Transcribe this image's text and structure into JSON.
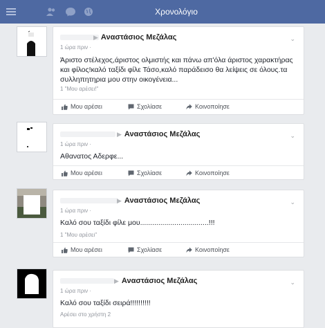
{
  "header": {
    "title": "Χρονολόγιο",
    "icons": [
      "menu-icon",
      "friends-icon",
      "messenger-icon",
      "globe-icon"
    ],
    "color": "#4e69a2"
  },
  "posts": [
    {
      "author": "Αναστάσιος Μεζάλας",
      "time": "1 ώρα πριν ·",
      "text": "Άριστο στέλεχος,άριστος ολμιστής και πάνω απ'όλα άριστος χαρακτήρας και φίλος!καλό ταξίδι φίλε Τάσο,καλό παράδεισο θα λείψεις σε όλους.τα συλληπητηρια μου στην οικογένεια...",
      "likes": "1 \"Μου αρέσει!\"",
      "actions": [
        "Μου αρέσει",
        "Σχολίασε",
        "Κοινοποίησε"
      ]
    },
    {
      "author": "Αναστάσιος Μεζάλας",
      "time": "1 ώρα πριν ·",
      "text": "Αθανατος Αδερφε...",
      "actions": [
        "Μου αρέσει",
        "Σχολίασε",
        "Κοινοποίησε"
      ]
    },
    {
      "author": "Αναστάσιος Μεζάλας",
      "time": "1 ώρα πριν ·",
      "text": "Καλό σου ταξίδι φίλε μου..................................!!!",
      "likes": "1 \"Μου αρέσει\"",
      "actions": [
        "Μου αρέσει",
        "Σχολίασε",
        "Κοινοποίησε"
      ]
    },
    {
      "author": "Αναστάσιος Μεζάλας",
      "time": "1 ώρα πριν ·",
      "text": "Καλό σου ταξίδι σειρά!!!!!!!!!!",
      "likes": "Αρέσει στο χρήστη 2"
    }
  ]
}
